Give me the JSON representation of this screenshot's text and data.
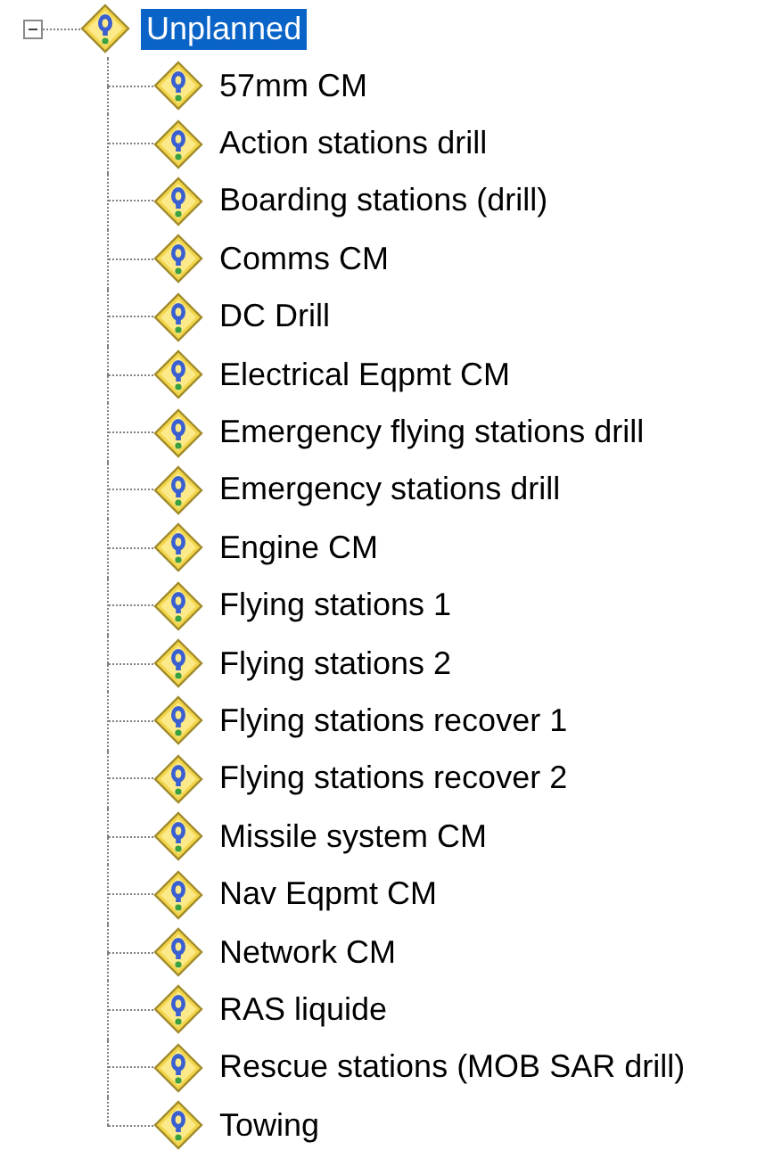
{
  "tree": {
    "label": "Unplanned",
    "expanded": true,
    "selected": true,
    "children": [
      {
        "label": "57mm CM",
        "selected": false
      },
      {
        "label": "Action stations drill",
        "selected": false
      },
      {
        "label": "Boarding stations (drill)",
        "selected": false
      },
      {
        "label": "Comms CM",
        "selected": false
      },
      {
        "label": "DC Drill",
        "selected": false
      },
      {
        "label": "Electrical Eqpmt CM",
        "selected": false
      },
      {
        "label": "Emergency flying stations drill",
        "selected": false
      },
      {
        "label": "Emergency stations drill",
        "selected": false
      },
      {
        "label": "Engine CM",
        "selected": false
      },
      {
        "label": "Flying stations 1",
        "selected": false
      },
      {
        "label": "Flying stations 2",
        "selected": false
      },
      {
        "label": "Flying stations recover 1",
        "selected": false
      },
      {
        "label": "Flying stations recover 2",
        "selected": false
      },
      {
        "label": "Missile system CM",
        "selected": false
      },
      {
        "label": "Nav Eqpmt CM",
        "selected": false
      },
      {
        "label": "Network CM",
        "selected": false
      },
      {
        "label": "RAS liquide",
        "selected": false
      },
      {
        "label": "Rescue stations (MOB SAR drill)",
        "selected": false
      },
      {
        "label": "Towing",
        "selected": false
      }
    ]
  }
}
